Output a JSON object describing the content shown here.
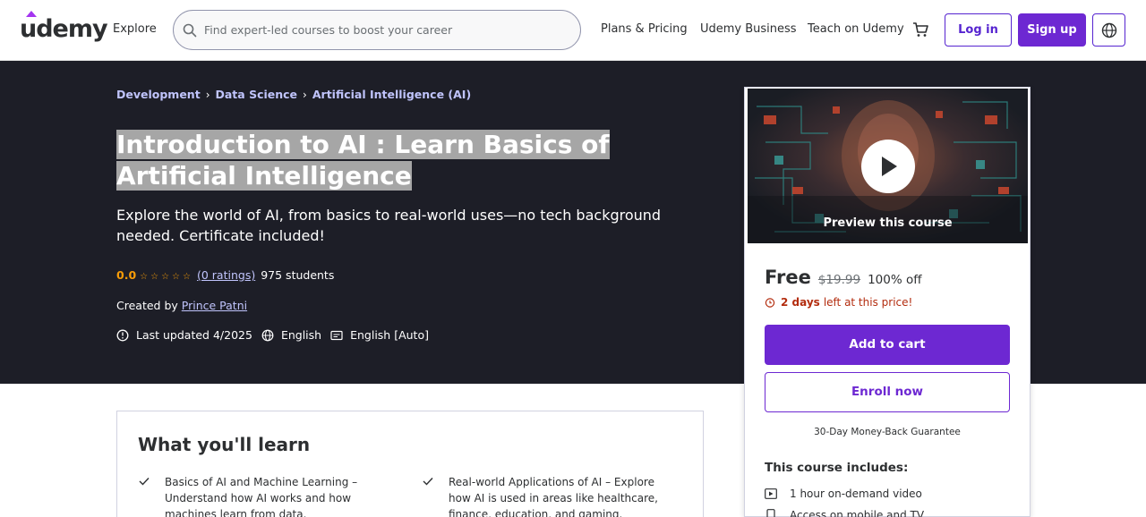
{
  "header": {
    "logo": "udemy",
    "explore": "Explore",
    "search_placeholder": "Find expert-led courses to boost your career",
    "nav": [
      "Plans & Pricing",
      "Udemy Business",
      "Teach on Udemy"
    ],
    "login": "Log in",
    "signup": "Sign up"
  },
  "breadcrumbs": [
    "Development",
    "Data Science",
    "Artificial Intelligence (AI)"
  ],
  "course": {
    "title": "Introduction to AI : Learn Basics of Artificial Intelligence",
    "subtitle": "Explore the world of AI, from basics to real-world uses—no tech background needed. Certificate included!",
    "rating_score": "0.0",
    "ratings_link": "(0 ratings)",
    "students": "975 students",
    "created_by_label": "Created by",
    "instructor": "Prince Patni",
    "last_updated": "Last updated 4/2025",
    "language": "English",
    "captions": "English [Auto]"
  },
  "sidebar": {
    "preview_label": "Preview this course",
    "price": "Free",
    "original_price": "$19.99",
    "discount": "100% off",
    "timer_bold": "2 days",
    "timer_rest": "left at this price!",
    "add_to_cart": "Add to cart",
    "enroll_now": "Enroll now",
    "guarantee": "30-Day Money-Back Guarantee",
    "includes_title": "This course includes:",
    "includes": [
      "1 hour on-demand video",
      "Access on mobile and TV"
    ]
  },
  "learn": {
    "title": "What you'll learn",
    "items": [
      "Basics of AI and Machine Learning – Understand how AI works and how machines learn from data.",
      "Real-world Applications of AI – Explore how AI is used in areas like healthcare, finance, education, and gaming."
    ]
  },
  "colors": {
    "brand_purple": "#6d28d2",
    "hero_bg": "#1d1e27",
    "link_lavender": "#c0c4fc",
    "rating_orange": "#f69c08",
    "timer_red": "#b32d0f"
  }
}
